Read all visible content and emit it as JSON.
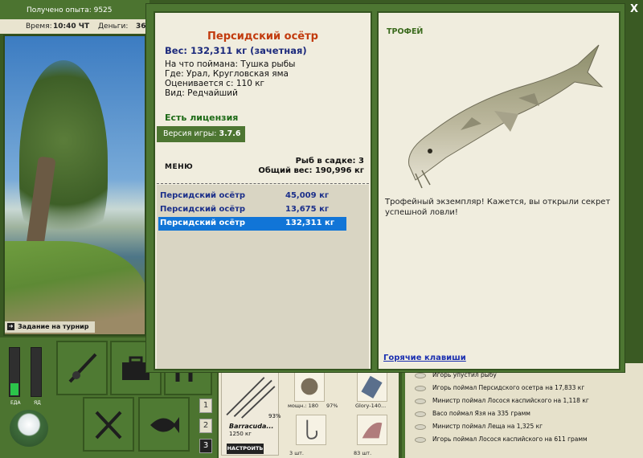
{
  "status": {
    "xp_text": "Получено опыта: 9525",
    "time_label": "Время:",
    "time_value": "10:40 ЧТ",
    "money_label": "Деньги:",
    "money_value": "36"
  },
  "scene": {
    "tournament_task": "Задание на турнир"
  },
  "meters": {
    "food_label": "ЕДА",
    "poison_label": "ЯД",
    "food_level": 0.25,
    "poison_level": 0.0
  },
  "toolbar": {
    "buttons": [
      "rod-icon",
      "tackle-box-icon",
      "map-icon",
      "fork-knife-icon",
      "fish-icon"
    ],
    "slots": [
      "1",
      "2",
      "3"
    ],
    "active_slot": 3
  },
  "inventory": {
    "rod_name": "Barracuda...",
    "rod_weight": "1250 кг",
    "rod_condition": "93%",
    "setup_button": "НАСТРОИТЬ",
    "items": [
      {
        "label": "мощн.: 180",
        "icon": "reel-icon"
      },
      {
        "label": "97%",
        "icon": "line-icon"
      },
      {
        "label": "Glory-140...",
        "icon": "lure-icon"
      },
      {
        "label": "3 шт.",
        "icon": "hook-icon"
      },
      {
        "label": "83 шт.",
        "icon": "bait-icon"
      }
    ]
  },
  "chat": {
    "lines": [
      "Игорь упустил рыбу",
      "Игорь поймал Персидского осетра на 17,833 кг",
      "Министр поймал Лосося каспийского на 1,118 кг",
      "Васо поймал Язя на 335 грамм",
      "Министр поймал Леща на 1,325 кг",
      "Игорь поймал Лосося каспийского на 611 грамм"
    ]
  },
  "dialog": {
    "close_label": "X",
    "fish_name": "Персидский осётр",
    "weight_text": "Вес: 132,311 кг (зачетная)",
    "caught_on": "На что поймана: Тушка рыбы",
    "location": "Где: Урал, Кругловская яма",
    "value": "Оценивается с: 110 кг",
    "rarity": "Вид: Редчайший",
    "license": "Есть лицензия",
    "version_label": "Версия игры:",
    "version_value": "3.7.6",
    "menu_label": "МЕНЮ",
    "cage_count": "Рыб в садке: 3",
    "total_weight": "Общий вес: 190,996 кг",
    "catches": [
      {
        "name": "Персидский осётр",
        "weight": "45,009 кг",
        "selected": false
      },
      {
        "name": "Персидский осётр",
        "weight": "13,675 кг",
        "selected": false
      },
      {
        "name": "Персидский осётр",
        "weight": "132,311 кг",
        "selected": true
      }
    ],
    "trophy_label": "ТРОФЕЙ",
    "trophy_text": "Трофейный экземпляр! Кажется, вы открыли секрет успешной ловли!",
    "hotkeys_link": "Горячие клавиши"
  },
  "colors": {
    "panel_green": "#4d7632",
    "selection_blue": "#1175d7",
    "title_red": "#c23b0e",
    "weight_navy": "#1c2a7c"
  }
}
